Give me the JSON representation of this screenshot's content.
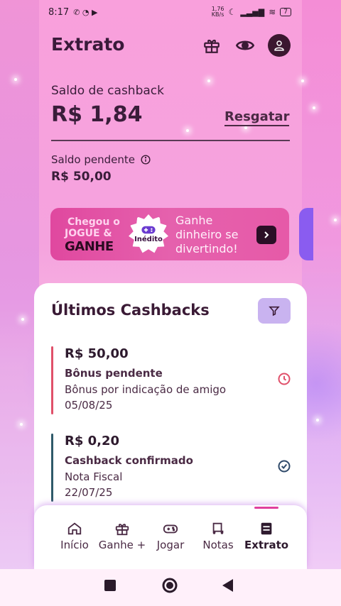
{
  "status_bar": {
    "time": "8:17",
    "net_speed": "1,76\nKB/s",
    "battery": "7"
  },
  "header": {
    "title": "Extrato"
  },
  "balance": {
    "cashback_label": "Saldo de cashback",
    "cashback_value": "R$ 1,84",
    "redeem_label": "Resgatar",
    "pending_label": "Saldo pendente",
    "pending_value": "R$ 50,00"
  },
  "banner": {
    "line1": "Chegou o",
    "line2": "JOGUE &",
    "line3": "GANHE",
    "badge": "Inédito",
    "text": "Ganhe dinheiro se divertindo!"
  },
  "recent": {
    "title": "Últimos Cashbacks",
    "entries": [
      {
        "amount": "R$ 50,00",
        "kind": "Bônus pendente",
        "description": "Bônus por indicação de amigo",
        "date": "05/08/25",
        "status": "pending",
        "accent": "#e0506a"
      },
      {
        "amount": "R$ 0,20",
        "kind": "Cashback confirmado",
        "description": "Nota Fiscal",
        "date": "22/07/25",
        "status": "confirmed",
        "accent": "#2f5a6a"
      }
    ]
  },
  "nav": {
    "items": [
      {
        "label": "Início",
        "icon": "home-icon"
      },
      {
        "label": "Ganhe +",
        "icon": "gift-icon"
      },
      {
        "label": "Jogar",
        "icon": "gamepad-icon"
      },
      {
        "label": "Notas",
        "icon": "receipt-icon"
      },
      {
        "label": "Extrato",
        "icon": "statement-icon",
        "active": true
      }
    ]
  },
  "colors": {
    "brand_pink": "#e0489f",
    "filter_purple": "#c9b3f0",
    "dark": "#3a1a35"
  }
}
